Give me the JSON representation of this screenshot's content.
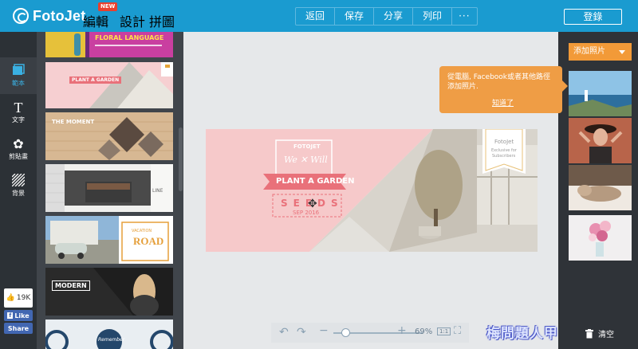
{
  "app": {
    "logo_text": "FotoJet"
  },
  "nav": {
    "edit": "編輯",
    "new_badge": "NEW",
    "design": "設計",
    "collage": "拼圖"
  },
  "toolbar": {
    "back": "返回",
    "save": "保存",
    "share": "分享",
    "print": "列印",
    "more": "···"
  },
  "login": "登錄",
  "rail": {
    "items": [
      {
        "label": "範本",
        "icon": "template-icon"
      },
      {
        "label": "文字",
        "icon": "text-icon"
      },
      {
        "label": "剪貼畫",
        "icon": "clipart-icon"
      },
      {
        "label": "背景",
        "icon": "background-icon"
      }
    ],
    "fb_count": "19K",
    "fb_like": "Like",
    "fb_share": "Share"
  },
  "templates": [
    {
      "title": "FLORAL LANGUAGE"
    },
    {
      "title": "PLANT A GARDEN"
    },
    {
      "title": "THE MOMENT"
    },
    {
      "title": "LINE"
    },
    {
      "title": "ROAD",
      "subtitle": "VACATION"
    },
    {
      "title": "MODERN"
    },
    {
      "title": "Remember"
    }
  ],
  "design": {
    "brand": "FOTOJET",
    "names": "We ✕ Will",
    "headline": "PLANT A GARDEN",
    "seeds": "SEEDS",
    "date": "SEP 2016",
    "corner_brand": "FotoJet",
    "corner_line1": "Exclusive for",
    "corner_line2": "Subscribers",
    "colors": {
      "pink": "#f6c9ca",
      "coral": "#e9717a",
      "canvas_bg": "#e6e8ea"
    }
  },
  "zoom": {
    "minus": "−",
    "plus": "+",
    "value": "69%",
    "fit": "1:1"
  },
  "right": {
    "add_photo": "添加照片",
    "clear": "清空"
  },
  "tooltip": {
    "line1": "從電腦, Facebook或者其他路徑",
    "line2": "添加照片.",
    "link": "知道了"
  },
  "watermark": "梅問題人甲"
}
